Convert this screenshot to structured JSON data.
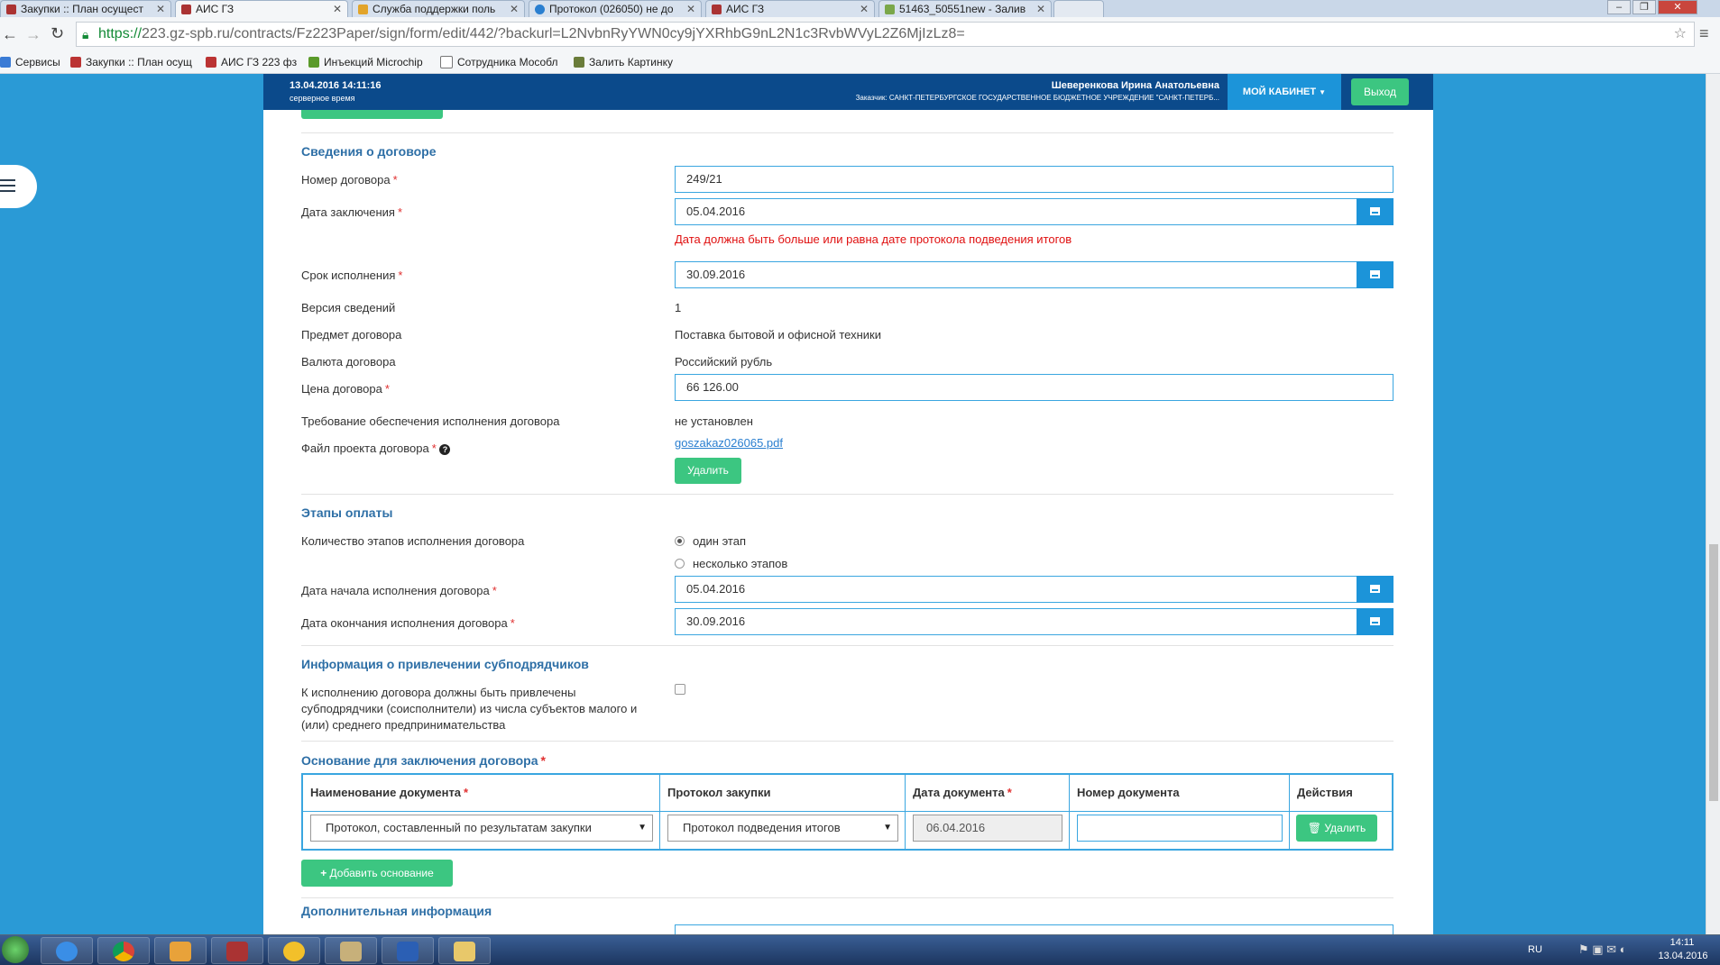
{
  "browser": {
    "tabs": [
      {
        "title": "Закупки :: План осущест"
      },
      {
        "title": "АИС ГЗ"
      },
      {
        "title": "Служба поддержки поль"
      },
      {
        "title": "Протокол (026050) не до"
      },
      {
        "title": "АИС ГЗ"
      },
      {
        "title": "51463_50551new - Залив"
      }
    ],
    "url_scheme": "https://",
    "url_rest": "223.gz-spb.ru/contracts/Fz223Paper/sign/form/edit/442/?backurl=L2NvbnRyYWN0cy9jYXRhbG9nL2N1c3RvbWVyL2Z6MjIzLz8=",
    "bookmarks": [
      "Сервисы",
      "Закупки :: План осущ",
      "АИС ГЗ 223 фз",
      "Инъекций Microchip",
      "Сотрудника Мособл",
      "Залить Картинку"
    ]
  },
  "header": {
    "datetime": "13.04.2016 14:11:16",
    "datetime_note": "серверное время",
    "user_name": "Шеверенкова Ирина Анатольевна",
    "customer": "Заказчик: САНКТ-ПЕТЕРБУРГСКОЕ ГОСУДАРСТВЕННОЕ БЮДЖЕТНОЕ УЧРЕЖДЕНИЕ \"САНКТ-ПЕТЕРБ...",
    "cabinet_label": "МОЙ КАБИНЕТ",
    "exit_label": "Выход"
  },
  "contract": {
    "section_title": "Сведения о договоре",
    "number_label": "Номер договора",
    "number_value": "249/21",
    "date_label": "Дата заключения",
    "date_value": "05.04.2016",
    "date_error": "Дата должна быть больше или равна дате протокола подведения итогов",
    "term_label": "Срок исполнения",
    "term_value": "30.09.2016",
    "version_label": "Версия сведений",
    "version_value": "1",
    "subject_label": "Предмет договора",
    "subject_value": "Поставка бытовой и офисной техники",
    "currency_label": "Валюта договора",
    "currency_value": "Российский рубль",
    "price_label": "Цена договора",
    "price_value": "66 126.00",
    "security_label": "Требование обеспечения исполнения договора",
    "security_value": "не установлен",
    "file_label": "Файл проекта договора",
    "file_link": "goszakaz026065.pdf",
    "delete_label": "Удалить"
  },
  "payment": {
    "section_title": "Этапы оплаты",
    "stages_label": "Количество этапов исполнения договора",
    "option_one": "один этап",
    "option_many": "несколько этапов",
    "start_label": "Дата начала исполнения договора",
    "start_value": "05.04.2016",
    "end_label": "Дата окончания исполнения договора",
    "end_value": "30.09.2016"
  },
  "subcontractors": {
    "section_title": "Информация о привлечении субподрядчиков",
    "line1": "К исполнению договора должны быть привлечены",
    "line2": "субподрядчики (соисполнители) из числа субъектов малого и",
    "line3": "(или) среднего предпринимательства"
  },
  "basis": {
    "section_title": "Основание для заключения договора",
    "columns": [
      "Наименование документа",
      "Протокол закупки",
      "Дата документа",
      "Номер документа",
      "Действия"
    ],
    "row": {
      "doc_name": "Протокол, составленный по результатам закупки",
      "protocol": "Протокол подведения итогов",
      "doc_date": "06.04.2016",
      "doc_number": "",
      "delete_label": "Удалить"
    },
    "add_label": "Добавить основание"
  },
  "additional": {
    "section_title": "Дополнительная информация"
  },
  "taskbar": {
    "lang": "RU",
    "time": "14:11",
    "date": "13.04.2016"
  },
  "colors": {
    "brand_blue": "#0b4a8b",
    "accent_blue": "#1c94d9",
    "green": "#3cc681",
    "error_red": "#e01010"
  }
}
